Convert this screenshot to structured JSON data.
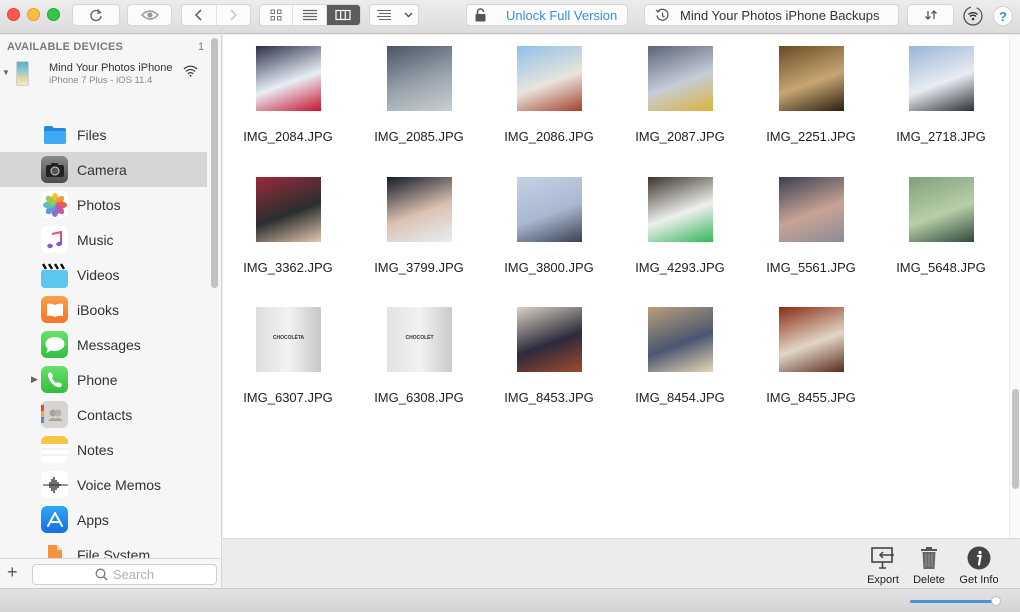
{
  "toolbar": {
    "unlock_label": "Unlock Full Version",
    "backups_label": "Mind Your Photos iPhone Backups",
    "help_label": "?",
    "view_modes": [
      "icon-view",
      "list-view",
      "column-view"
    ],
    "active_view": "column-view"
  },
  "sidebar": {
    "devices_header": "AVAILABLE DEVICES",
    "devices_count": "1",
    "device": {
      "name": "Mind Your Photos iPhone",
      "subtitle": "iPhone 7 Plus - iOS 11.4",
      "connection": "wifi"
    },
    "items": [
      {
        "label": "Files",
        "icon": "files-icon",
        "selected": false
      },
      {
        "label": "Camera",
        "icon": "camera-icon",
        "selected": true
      },
      {
        "label": "Photos",
        "icon": "photos-icon",
        "selected": false
      },
      {
        "label": "Music",
        "icon": "music-icon",
        "selected": false
      },
      {
        "label": "Videos",
        "icon": "videos-icon",
        "selected": false
      },
      {
        "label": "iBooks",
        "icon": "ibooks-icon",
        "selected": false
      },
      {
        "label": "Messages",
        "icon": "messages-icon",
        "selected": false
      },
      {
        "label": "Phone",
        "icon": "phone-icon",
        "selected": false,
        "expandable": true
      },
      {
        "label": "Contacts",
        "icon": "contacts-icon",
        "selected": false
      },
      {
        "label": "Notes",
        "icon": "notes-icon",
        "selected": false
      },
      {
        "label": "Voice Memos",
        "icon": "voice-memos-icon",
        "selected": false
      },
      {
        "label": "Apps",
        "icon": "apps-icon",
        "selected": false
      },
      {
        "label": "File System",
        "icon": "file-system-icon",
        "selected": false
      }
    ],
    "search_placeholder": "Search"
  },
  "files": [
    {
      "name": "IMG_2084.JPG",
      "colors": [
        "#2a2f4a",
        "#e8eef5",
        "#c8102e"
      ]
    },
    {
      "name": "IMG_2085.JPG",
      "colors": [
        "#4a5563",
        "#9aa3ad",
        "#c9ced3"
      ]
    },
    {
      "name": "IMG_2086.JPG",
      "colors": [
        "#8fc0ea",
        "#e9e4dc",
        "#a3402c"
      ]
    },
    {
      "name": "IMG_2087.JPG",
      "colors": [
        "#5a6478",
        "#c8ccd8",
        "#d7b43a"
      ]
    },
    {
      "name": "IMG_2251.JPG",
      "colors": [
        "#6b4a24",
        "#c7a673",
        "#2a1d10"
      ]
    },
    {
      "name": "IMG_2718.JPG",
      "colors": [
        "#9ab4d6",
        "#e8ecf2",
        "#2b2f3a"
      ]
    },
    {
      "name": "IMG_3362.JPG",
      "colors": [
        "#9a2a3a",
        "#2a2e2e",
        "#e5c6b2"
      ]
    },
    {
      "name": "IMG_3799.JPG",
      "colors": [
        "#131a2a",
        "#dcc2b0",
        "#e7eef6"
      ]
    },
    {
      "name": "IMG_3800.JPG",
      "colors": [
        "#c4d2e6",
        "#a9b8cf",
        "#3a4252"
      ]
    },
    {
      "name": "IMG_4293.JPG",
      "colors": [
        "#3b3328",
        "#eef0ee",
        "#33b55a"
      ]
    },
    {
      "name": "IMG_5561.JPG",
      "colors": [
        "#3a3f52",
        "#c9a394",
        "#8c8c96"
      ]
    },
    {
      "name": "IMG_5648.JPG",
      "colors": [
        "#7fa07a",
        "#b7cfa8",
        "#2f4a3a"
      ]
    },
    {
      "name": "IMG_6307.JPG",
      "colors": [
        "#dedede",
        "#c8c8c8",
        "#333333"
      ],
      "caption": "CHOCOLÉTA"
    },
    {
      "name": "IMG_6308.JPG",
      "colors": [
        "#e2e2e2",
        "#cbcbcb",
        "#333333"
      ],
      "caption": "CHOCOLÉT"
    },
    {
      "name": "IMG_8453.JPG",
      "colors": [
        "#dcd3c4",
        "#2c2a3c",
        "#a24a2c"
      ]
    },
    {
      "name": "IMG_8454.JPG",
      "colors": [
        "#b89f7a",
        "#4a5670",
        "#e7d6b6"
      ]
    },
    {
      "name": "IMG_8455.JPG",
      "colors": [
        "#8a2c14",
        "#e2d6c7",
        "#5a2a1a"
      ]
    }
  ],
  "actions": [
    {
      "label": "Export",
      "icon": "export-icon"
    },
    {
      "label": "Delete",
      "icon": "trash-icon"
    },
    {
      "label": "Get Info",
      "icon": "info-icon"
    }
  ],
  "zoom_level": 1.0,
  "colors": {
    "accent": "#3a8fd6",
    "selection": "#d6d6d6"
  }
}
